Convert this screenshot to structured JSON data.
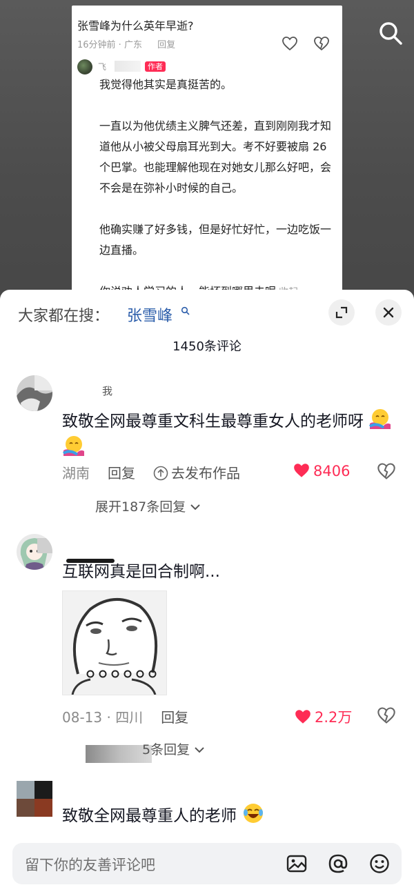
{
  "video_overlay": {
    "card": {
      "title": "张雪峰为什么英年早逝?",
      "time": "16分钟前 · 广东",
      "reply_label": "回复",
      "reply": {
        "name": "飞",
        "author_badge": "作者",
        "paragraphs": [
          "我觉得他其实是真挺苦的。",
          "一直以为他优绩主义脾气还差，直到刚刚我才知道他从小被父母扇耳光到大。考不好要被扇 26 个巴掌。也能理解他现在对她女儿那么好吧，会不会是在弥补小时候的自己。",
          "他确实赚了好多钱，但是好忙好忙，一边吃饭一边直播。",
          "你说劝人学习的人，能坏到哪里去呢"
        ],
        "collapse_label": "收起"
      }
    }
  },
  "sheet": {
    "trending_label": "大家都在搜：",
    "trending_term": "张雪峰",
    "comment_count": "1450条评论",
    "comments": [
      {
        "author_tag": "我",
        "text": "致敬全网最尊重文科生最尊重女人的老师呀",
        "location": "湖南",
        "reply_label": "回复",
        "publish_label": "去发布作品",
        "likes": "8406",
        "expand_label": "展开187条回复"
      },
      {
        "text": "互联网真是回合制啊...",
        "date": "08-13 · 四川",
        "reply_label": "回复",
        "likes": "2.2万",
        "expand_label": "5条回复"
      },
      {
        "text": "致敬全网最尊重人的老师"
      }
    ]
  },
  "input": {
    "placeholder": "留下你的友善评论吧"
  },
  "colors": {
    "accent": "#fe2c55",
    "link": "#2a5caa"
  }
}
